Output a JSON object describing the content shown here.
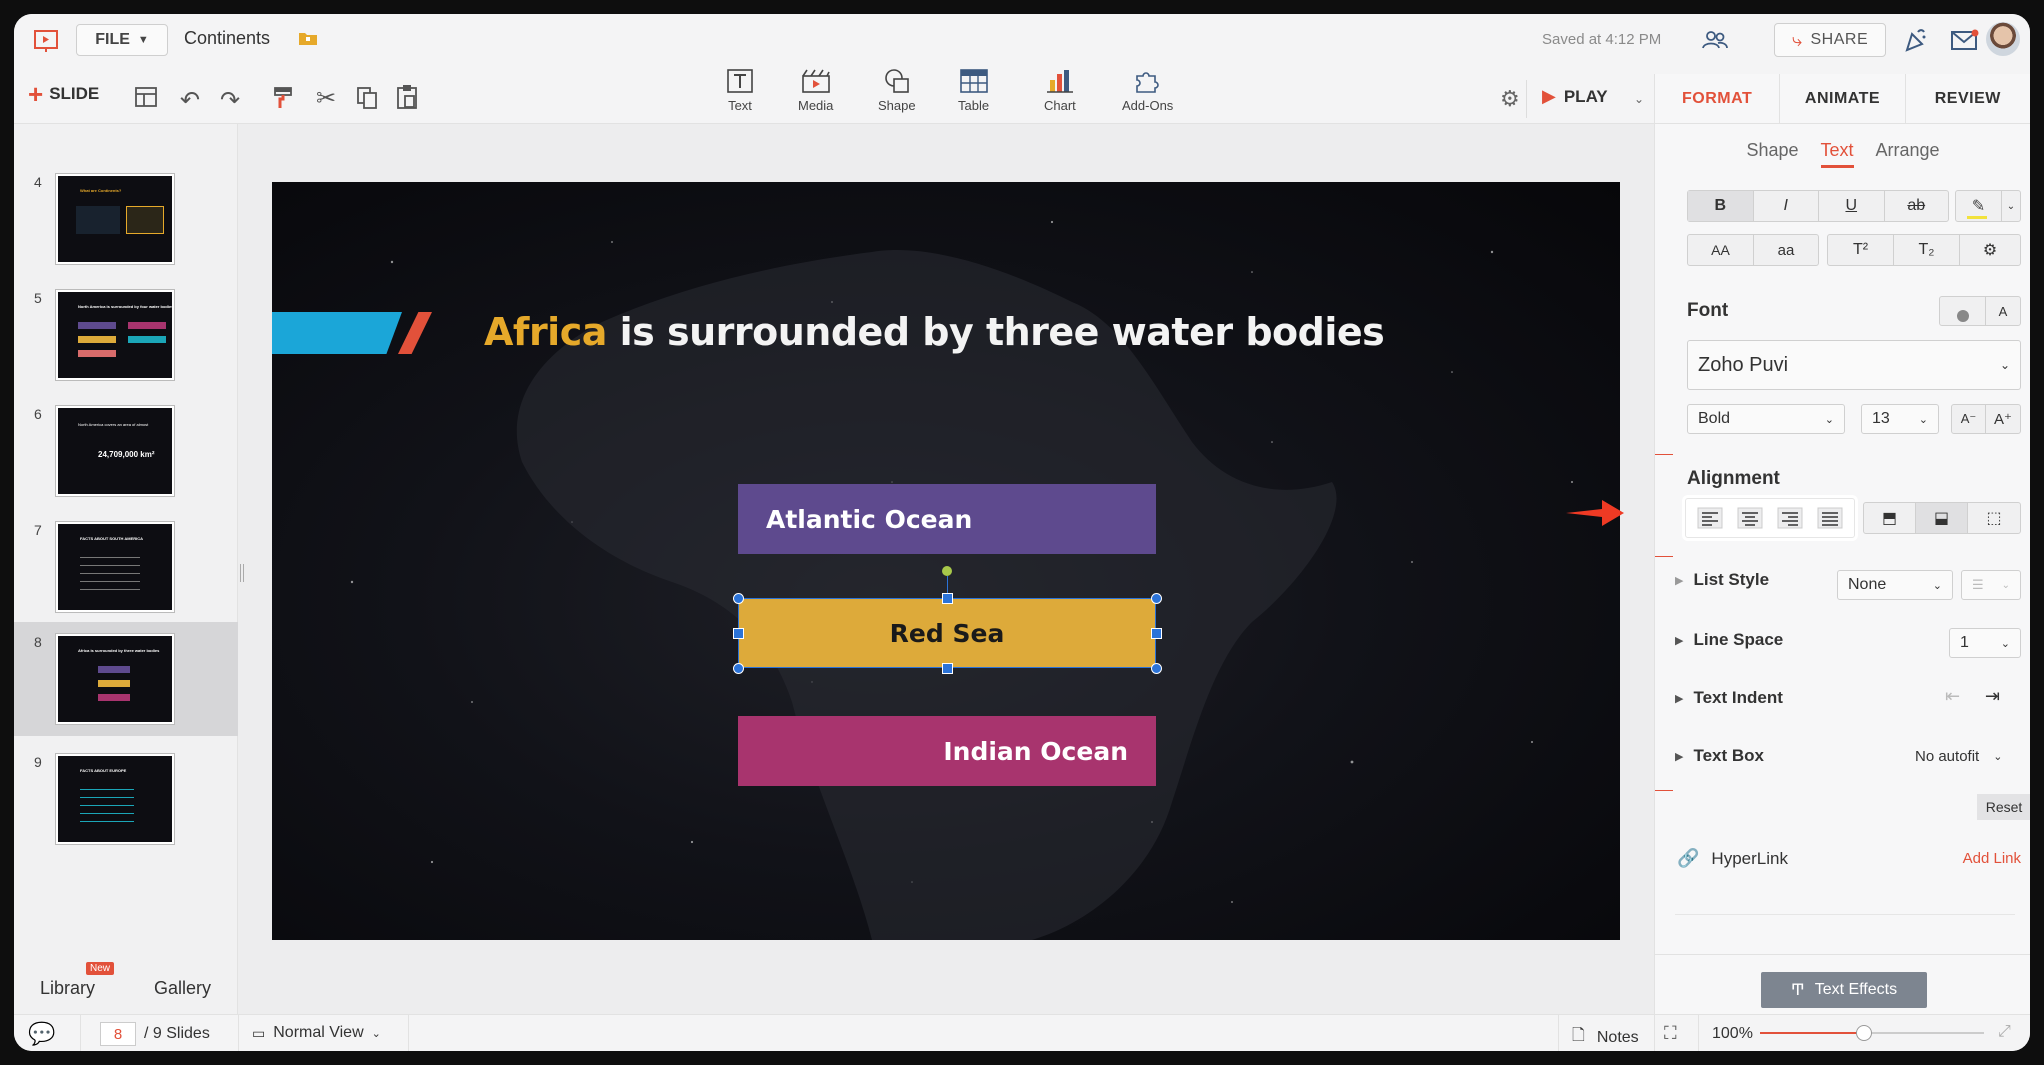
{
  "app": {
    "file_label": "FILE",
    "doc_title": "Continents",
    "saved": "Saved at 4:12 PM",
    "share_label": "SHARE",
    "play_label": "PLAY"
  },
  "toolbar": {
    "slide_label": "SLIDE",
    "insert": [
      {
        "label": "Text",
        "icon": "text-box-icon"
      },
      {
        "label": "Media",
        "icon": "media-icon"
      },
      {
        "label": "Shape",
        "icon": "shape-icon"
      },
      {
        "label": "Table",
        "icon": "table-icon"
      },
      {
        "label": "Chart",
        "icon": "chart-icon"
      },
      {
        "label": "Add-Ons",
        "icon": "puzzle-icon"
      }
    ]
  },
  "slides_panel": {
    "slides": [
      {
        "num": "4",
        "title": "What are Continents?"
      },
      {
        "num": "5",
        "title": "North America is surrounded by four water bodies"
      },
      {
        "num": "6",
        "title": "North America covers an area of almost",
        "big": "24,709,000 km²"
      },
      {
        "num": "7",
        "title": "FACTS ABOUT SOUTH AMERICA"
      },
      {
        "num": "8",
        "title": "Africa is surrounded by three water bodies"
      },
      {
        "num": "9",
        "title": "FACTS ABOUT EUROPE"
      }
    ],
    "active_index": 4,
    "library_label": "Library",
    "new_badge": "New",
    "gallery_label": "Gallery"
  },
  "slide": {
    "title_accent": "Africa",
    "title_rest": " is surrounded by three water bodies",
    "boxes": [
      {
        "label": "Atlantic Ocean"
      },
      {
        "label": "Red Sea"
      },
      {
        "label": "Indian Ocean"
      }
    ]
  },
  "format_panel": {
    "tabs": [
      "FORMAT",
      "ANIMATE",
      "REVIEW"
    ],
    "subtabs": [
      "Shape",
      "Text",
      "Arrange"
    ],
    "font_heading": "Font",
    "font_name": "Zoho Puvi",
    "font_weight": "Bold",
    "font_size": "13",
    "alignment_heading": "Alignment",
    "list_style_label": "List Style",
    "list_style_value": "None",
    "line_space_label": "Line Space",
    "line_space_value": "1",
    "text_indent_label": "Text Indent",
    "text_box_label": "Text Box",
    "text_box_value": "No autofit",
    "reset_label": "Reset",
    "hyperlink_label": "HyperLink",
    "add_link_label": "Add Link",
    "text_effects_label": "Text Effects"
  },
  "status": {
    "current_slide": "8",
    "total_slides": "/ 9 Slides",
    "view_label": "Normal View",
    "notes_label": "Notes",
    "zoom": "100%"
  },
  "colors": {
    "accent": "#e2513a",
    "title_accent": "#e6a92a",
    "atlantic": "#5e4a8e",
    "redsea": "#ddaa3a",
    "indian": "#a8346e"
  }
}
